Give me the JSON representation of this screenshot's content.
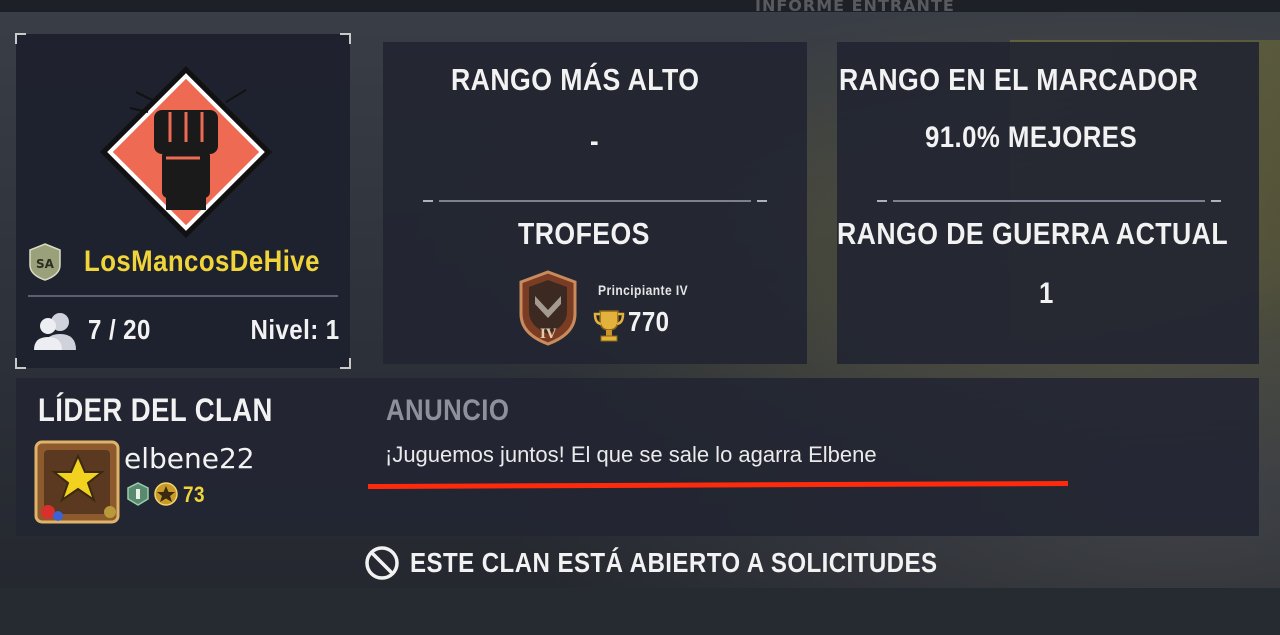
{
  "topbar": {
    "title": "INFORME ENTRANTE"
  },
  "clan": {
    "name": "LosMancosDeHive",
    "region_badge": "SA",
    "members": "7 / 20",
    "level": "Nivel: 1",
    "emblem_icon": "raised-fist-emblem-icon"
  },
  "stats": {
    "highest_rank_title": "RANGO MÁS ALTO",
    "highest_rank_value": "-",
    "trophies_title": "TROFEOS",
    "trophy_rank": "Principiante IV",
    "trophy_rank_numeral": "IV",
    "trophy_count": "770",
    "leaderboard_title": "RANGO EN EL MARCADOR",
    "leaderboard_value": "91.0% MEJORES",
    "war_rank_title": "RANGO DE GUERRA ACTUAL",
    "war_rank_value": "1"
  },
  "leader": {
    "heading": "LÍDER DEL CLAN",
    "name": "elbene22",
    "level": "73"
  },
  "announcement": {
    "heading": "ANUNCIO",
    "text": "¡Juguemos juntos! El que se sale lo agarra Elbene"
  },
  "status": {
    "open_text": "ESTE CLAN ESTÁ ABIERTO A SOLICITUDES"
  },
  "colors": {
    "clan_name": "#f0d43a",
    "emblem_bg": "#ef6a52",
    "annotation_line": "#ff2a0c",
    "announce_heading": "#8d919b"
  }
}
